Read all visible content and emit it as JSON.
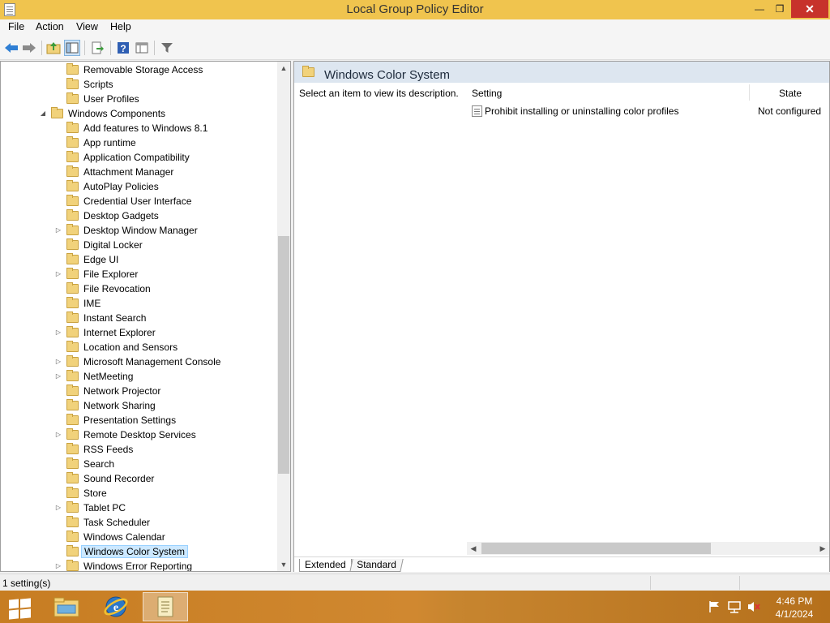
{
  "window": {
    "title": "Local Group Policy Editor",
    "minimize": "—",
    "maximize": "❐",
    "close": "✕"
  },
  "menu": [
    "File",
    "Action",
    "View",
    "Help"
  ],
  "tree": {
    "items": [
      {
        "label": "Removable Storage Access",
        "expander": ""
      },
      {
        "label": "Scripts",
        "expander": ""
      },
      {
        "label": "User Profiles",
        "expander": ""
      },
      {
        "label": "Windows Components",
        "expander": "◢"
      },
      {
        "label": "Add features to Windows 8.1",
        "expander": ""
      },
      {
        "label": "App runtime",
        "expander": ""
      },
      {
        "label": "Application Compatibility",
        "expander": ""
      },
      {
        "label": "Attachment Manager",
        "expander": ""
      },
      {
        "label": "AutoPlay Policies",
        "expander": ""
      },
      {
        "label": "Credential User Interface",
        "expander": ""
      },
      {
        "label": "Desktop Gadgets",
        "expander": ""
      },
      {
        "label": "Desktop Window Manager",
        "expander": "▷"
      },
      {
        "label": "Digital Locker",
        "expander": ""
      },
      {
        "label": "Edge UI",
        "expander": ""
      },
      {
        "label": "File Explorer",
        "expander": "▷"
      },
      {
        "label": "File Revocation",
        "expander": ""
      },
      {
        "label": "IME",
        "expander": ""
      },
      {
        "label": "Instant Search",
        "expander": ""
      },
      {
        "label": "Internet Explorer",
        "expander": "▷"
      },
      {
        "label": "Location and Sensors",
        "expander": ""
      },
      {
        "label": "Microsoft Management Console",
        "expander": "▷"
      },
      {
        "label": "NetMeeting",
        "expander": "▷"
      },
      {
        "label": "Network Projector",
        "expander": ""
      },
      {
        "label": "Network Sharing",
        "expander": ""
      },
      {
        "label": "Presentation Settings",
        "expander": ""
      },
      {
        "label": "Remote Desktop Services",
        "expander": "▷"
      },
      {
        "label": "RSS Feeds",
        "expander": ""
      },
      {
        "label": "Search",
        "expander": ""
      },
      {
        "label": "Sound Recorder",
        "expander": ""
      },
      {
        "label": "Store",
        "expander": ""
      },
      {
        "label": "Tablet PC",
        "expander": "▷"
      },
      {
        "label": "Task Scheduler",
        "expander": ""
      },
      {
        "label": "Windows Calendar",
        "expander": ""
      },
      {
        "label": "Windows Color System",
        "expander": "",
        "selected": true
      },
      {
        "label": "Windows Error Reporting",
        "expander": "▷"
      }
    ],
    "scroll_up": "▲",
    "scroll_down": "▼"
  },
  "details": {
    "title": "Windows Color System",
    "description": "Select an item to view its description.",
    "columns": {
      "setting": "Setting",
      "state": "State"
    },
    "rows": [
      {
        "setting": "Prohibit installing or uninstalling color profiles",
        "state": "Not configured"
      }
    ],
    "scroll_left": "◀",
    "scroll_right": "▶",
    "tabs": [
      "Extended",
      "Standard"
    ]
  },
  "status": {
    "text": "1 setting(s)"
  },
  "taskbar": {
    "time": "4:46 PM",
    "date": "4/1/2024"
  },
  "colors": {
    "titlebar": "#f0c44e",
    "close": "#c7322b",
    "taskbar": "#c77d22",
    "selection": "#cce8ff"
  },
  "icons": [
    "back-icon",
    "forward-icon",
    "up-folder-icon",
    "show-hide-tree-icon",
    "export-list-icon",
    "help-icon",
    "properties-icon",
    "filter-icon"
  ]
}
